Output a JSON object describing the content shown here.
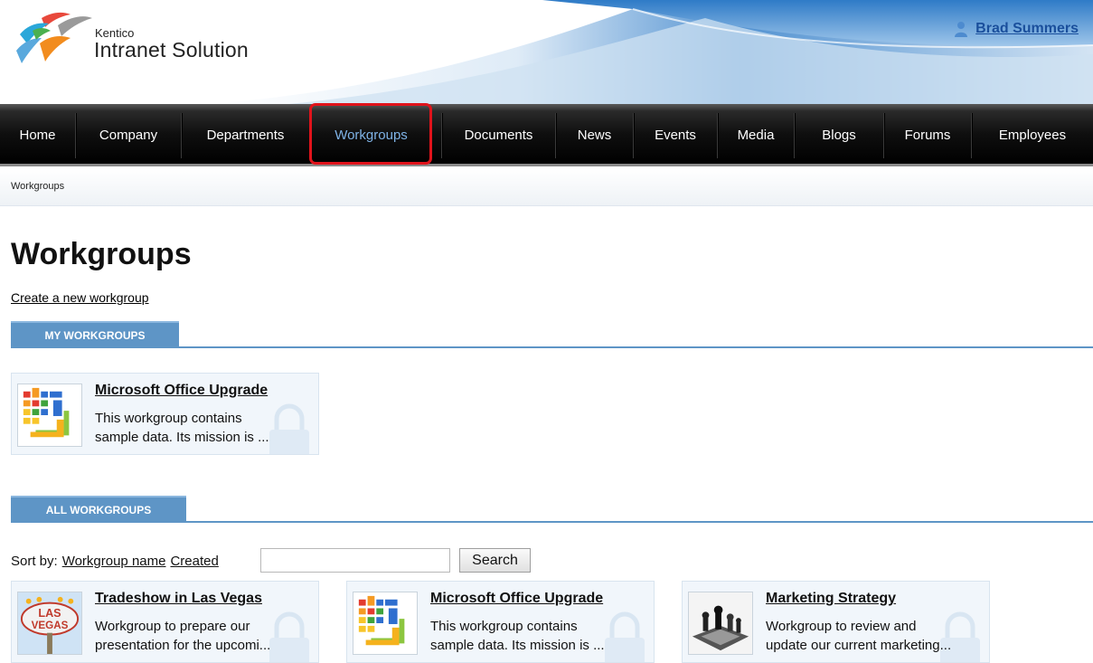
{
  "header": {
    "logo_sub": "Kentico",
    "logo_title": "Intranet Solution",
    "user_name": "Brad Summers"
  },
  "nav": {
    "items": [
      "Home",
      "Company",
      "Departments",
      "Workgroups",
      "Documents",
      "News",
      "Events",
      "Media",
      "Blogs",
      "Forums",
      "Employees"
    ],
    "active": "Workgroups"
  },
  "breadcrumb": {
    "current": "Workgroups"
  },
  "main": {
    "title": "Workgroups",
    "create_link": "Create a new workgroup",
    "my_workgroups": {
      "tab_label": "MY WORKGROUPS",
      "items": [
        {
          "name": "Microsoft Office Upgrade",
          "desc_line1": "This workgroup contains",
          "desc_line2": "sample data. Its mission is ..."
        }
      ]
    },
    "all_workgroups": {
      "tab_label": "ALL WORKGROUPS",
      "sort_label": "Sort by:",
      "sort_options": [
        "Workgroup name",
        "Created"
      ],
      "search_value": "",
      "search_button": "Search",
      "items": [
        {
          "name": "Tradeshow in Las Vegas",
          "desc_line1": "Workgroup to prepare our",
          "desc_line2": "presentation for the upcomi..."
        },
        {
          "name": "Microsoft Office Upgrade",
          "desc_line1": "This workgroup contains",
          "desc_line2": "sample data. Its mission is ..."
        },
        {
          "name": "Marketing Strategy",
          "desc_line1": "Workgroup to review and",
          "desc_line2": "update our current marketing..."
        }
      ]
    }
  },
  "colors": {
    "accent": "#5e95c6",
    "nav_bg": "#000000",
    "active_nav_text": "#7fb3e6",
    "highlight": "#e0131b",
    "user_link": "#1a4f9c"
  }
}
